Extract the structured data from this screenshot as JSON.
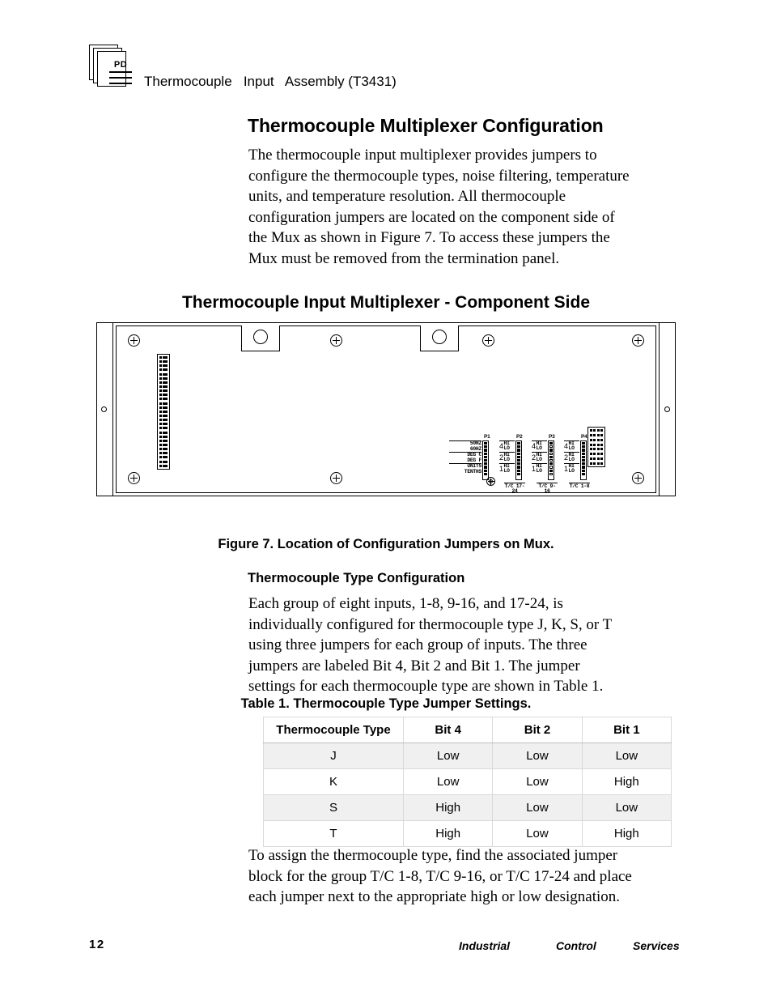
{
  "header": {
    "icon_label": "PD",
    "title": "Thermocouple   Input   Assembly (T3431)"
  },
  "section": {
    "title": "Thermocouple Multiplexer Configuration",
    "intro_paragraph": "The thermocouple input multiplexer provides jumpers to\nconfigure the thermocouple types, noise filtering, temperature\nunits, and temperature resolution.  All thermocouple\nconfiguration jumpers are located on the component side of\nthe Mux as shown in Figure 7.  To access these jumpers the\nMux must be removed from the termination panel."
  },
  "figure": {
    "title": "Thermocouple Input Multiplexer - Component Side",
    "caption": "Figure 7.  Location of Configuration Jumpers on Mux.",
    "jumper_blocks": [
      {
        "id": "P1",
        "label_pairs": [
          [
            "50HZ",
            "60HZ"
          ],
          [
            "DEG C",
            "DEG F"
          ],
          [
            "UNITS",
            "TENTHS"
          ]
        ]
      },
      {
        "id": "P2",
        "bits": [
          "4",
          "2",
          "1"
        ],
        "hi": "HI",
        "lo": "LO",
        "group": "T/C\n17-24"
      },
      {
        "id": "P3",
        "bits": [
          "4",
          "2",
          "1"
        ],
        "hi": "HI",
        "lo": "LO",
        "group": "T/C\n9-16"
      },
      {
        "id": "P4",
        "bits": [
          "4",
          "2",
          "1"
        ],
        "hi": "HI",
        "lo": "LO",
        "group": "T/C\n1-8"
      }
    ]
  },
  "tc_type": {
    "heading": "Thermocouple Type Configuration",
    "paragraph": "Each group of eight inputs, 1-8, 9-16, and 17-24, is\nindividually configured for thermocouple type J, K, S, or T\nusing three jumpers for each group of inputs.  The three\njumpers are labeled Bit 4, Bit 2 and Bit 1.  The jumper\nsettings for each thermocouple type are shown in Table 1."
  },
  "table": {
    "caption": "Table 1.  Thermocouple Type Jumper Settings.",
    "columns": [
      "Thermocouple Type",
      "Bit 4",
      "Bit 2",
      "Bit 1"
    ],
    "rows": [
      [
        "J",
        "Low",
        "Low",
        "Low"
      ],
      [
        "K",
        "Low",
        "Low",
        "High"
      ],
      [
        "S",
        "High",
        "Low",
        "Low"
      ],
      [
        "T",
        "High",
        "Low",
        "High"
      ]
    ]
  },
  "closing_paragraph": "To assign the thermocouple type, find the associated jumper\nblock for the group T/C 1-8, T/C 9-16, or T/C 17-24 and place\neach jumper next to the appropriate high or low designation.",
  "footer": {
    "page_number": "12",
    "words": [
      "Industrial",
      "Control",
      "Services"
    ]
  }
}
